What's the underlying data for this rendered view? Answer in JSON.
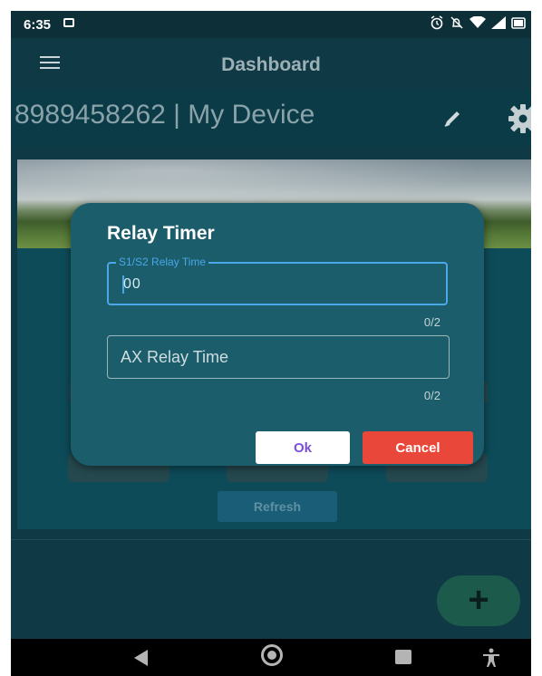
{
  "status_bar": {
    "time": "6:35",
    "icons": [
      "message-icon",
      "alarm-icon",
      "mute-icon",
      "wifi-icon",
      "signal-icon",
      "battery-icon"
    ]
  },
  "app_bar": {
    "menu_icon": "hamburger-icon",
    "title": "Dashboard"
  },
  "device": {
    "title": "8989458262 | My Device",
    "edit_icon": "pencil-icon",
    "settings_icon": "gear-icon"
  },
  "refresh_label": "Refresh",
  "fab": {
    "label": "+"
  },
  "dialog": {
    "title": "Relay Timer",
    "field1": {
      "label": "S1/S2 Relay Time",
      "value": "00",
      "counter": "0/2"
    },
    "field2": {
      "label": "AX Relay Time",
      "counter": "0/2"
    },
    "ok_label": "Ok",
    "cancel_label": "Cancel"
  },
  "nav_bar": {
    "icons": [
      "back-icon",
      "home-icon",
      "recents-icon",
      "accessibility-icon"
    ]
  },
  "colors": {
    "background": "#0f3a45",
    "dialog": "#1b5d6b",
    "focus_blue": "#49a8e8",
    "cancel_red": "#e8473a",
    "ok_text_purple": "#7b4fd8",
    "fab_green": "#1c5b4b"
  }
}
